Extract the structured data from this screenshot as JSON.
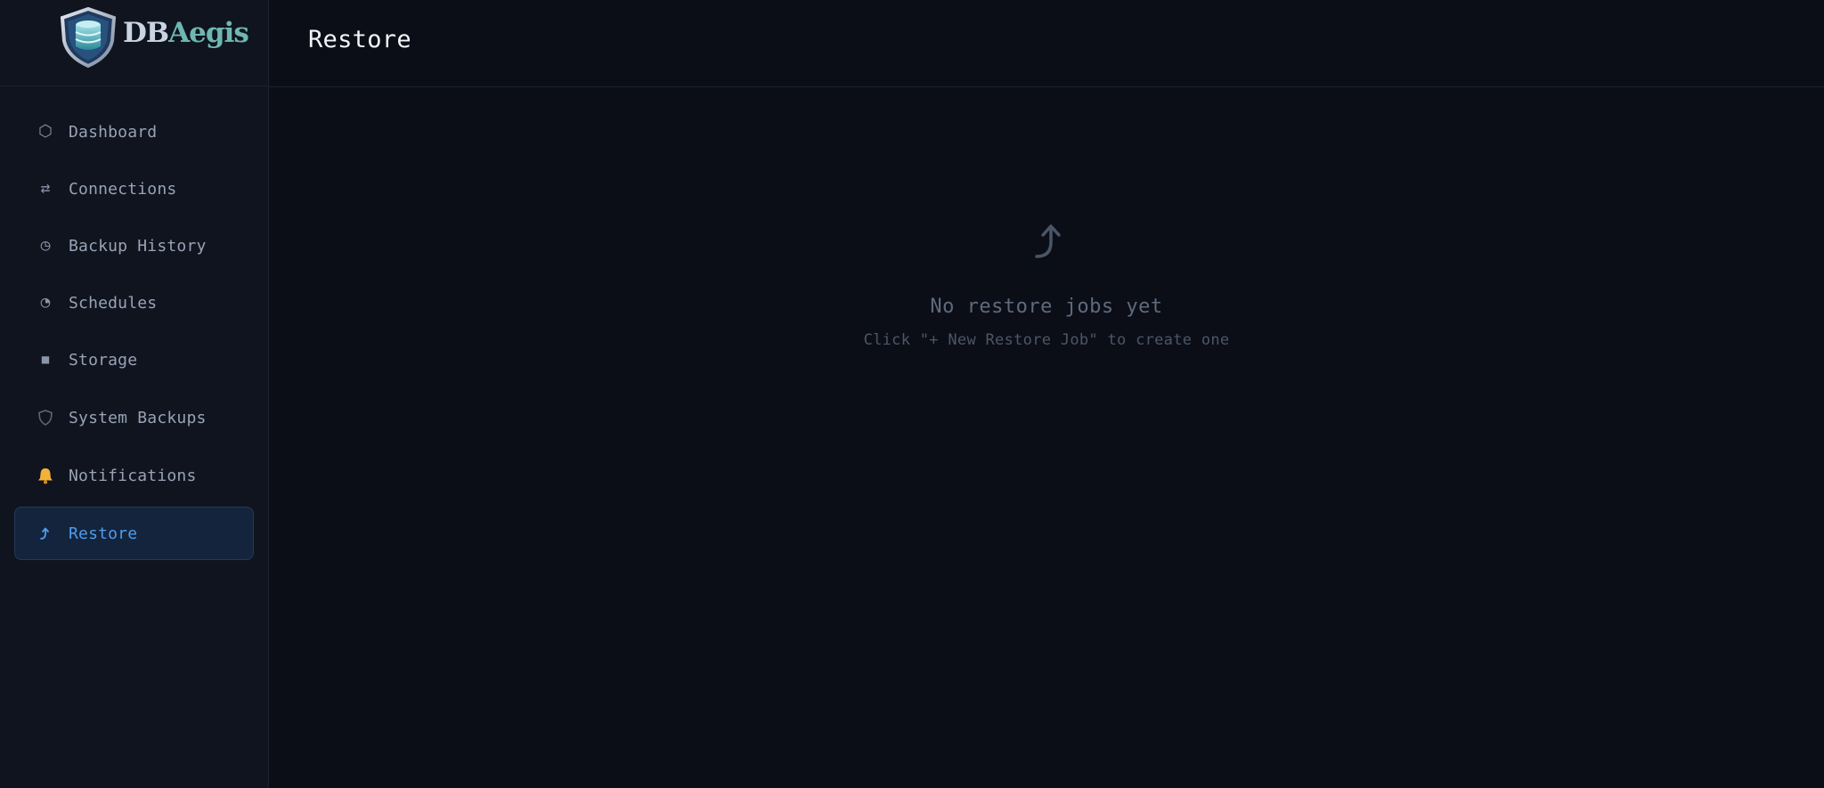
{
  "brand": {
    "name_part1": "DB",
    "name_part2": "Aegis"
  },
  "colors": {
    "background": "#0b0e16",
    "sidebar": "#0f141f",
    "accent": "#4d9cf0",
    "active_bg": "#14243c"
  },
  "sidebar": {
    "items": [
      {
        "label": "Dashboard",
        "icon": "hexagon-icon",
        "glyph": "⬡",
        "active": false
      },
      {
        "label": "Connections",
        "icon": "arrows-exchange-icon",
        "glyph": "⇄",
        "active": false
      },
      {
        "label": "Backup History",
        "icon": "clock-icon",
        "glyph": "◷",
        "active": false
      },
      {
        "label": "Schedules",
        "icon": "pie-clock-icon",
        "glyph": "◔",
        "active": false
      },
      {
        "label": "Storage",
        "icon": "square-icon",
        "glyph": "■",
        "active": false
      },
      {
        "label": "System Backups",
        "icon": "shield-icon",
        "glyph": "🛡",
        "active": false
      },
      {
        "label": "Notifications",
        "icon": "bell-icon",
        "glyph": "🔔",
        "active": false
      },
      {
        "label": "Restore",
        "icon": "restore-arrow-icon",
        "glyph": "⤴",
        "active": true
      }
    ]
  },
  "header": {
    "title": "Restore"
  },
  "empty_state": {
    "icon": "restore-arrow-icon",
    "title": "No restore jobs yet",
    "subtitle": "Click \"+ New Restore Job\" to create one"
  }
}
